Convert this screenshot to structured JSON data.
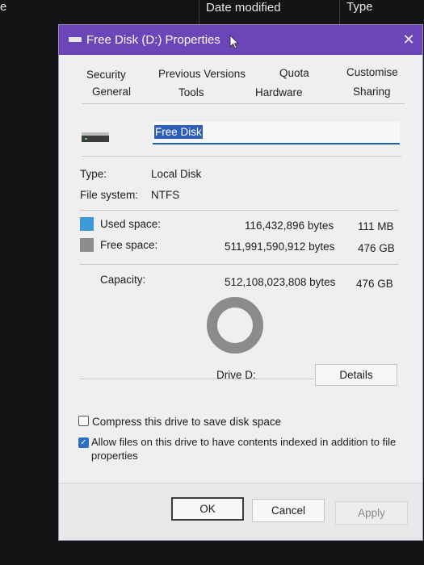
{
  "background": {
    "left_fragment": "e",
    "col_date_modified": "Date modified",
    "col_type": "Type"
  },
  "dialog": {
    "title": "Free Disk (D:) Properties",
    "close_glyph": "✕",
    "tabs_row1": [
      "Security",
      "Previous Versions",
      "Quota",
      "Customise"
    ],
    "tabs_row2": [
      "General",
      "Tools",
      "Hardware",
      "Sharing"
    ],
    "active_tab": "General",
    "drive_name": "Free Disk",
    "type_label": "Type:",
    "type_value": "Local Disk",
    "fs_label": "File system:",
    "fs_value": "NTFS",
    "used_label": "Used space:",
    "used_bytes": "116,432,896 bytes",
    "used_size": "111 MB",
    "free_label": "Free space:",
    "free_bytes": "511,991,590,912 bytes",
    "free_size": "476 GB",
    "capacity_label": "Capacity:",
    "capacity_bytes": "512,108,023,808 bytes",
    "capacity_size": "476 GB",
    "drive_caption": "Drive D:",
    "details_button": "Details",
    "compress_label": "Compress this drive to save disk space",
    "compress_checked": false,
    "index_label_line1": "Allow files on this drive to have contents indexed in addition to file",
    "index_label_line2": "properties",
    "index_checked": true,
    "ok_button": "OK",
    "cancel_button": "Cancel",
    "apply_button": "Apply",
    "used_fraction": 0.0002
  },
  "colors": {
    "titlebar": "#6b46b8",
    "used_swatch": "#3d9ad6",
    "free_swatch": "#8d8d8d",
    "selection": "#2d5fb8"
  },
  "icons": [
    "drive-icon",
    "mouse-cursor-icon",
    "close-icon",
    "checkmark-icon"
  ]
}
